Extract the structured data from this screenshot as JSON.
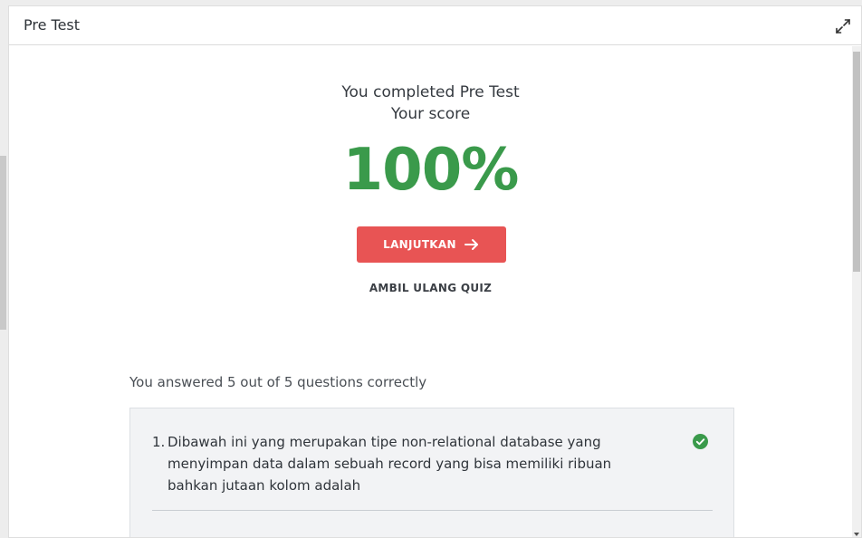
{
  "modal": {
    "title": "Pre Test",
    "expand_icon": "expand-arrows-icon"
  },
  "result": {
    "line1": "You completed Pre Test",
    "line2": "Your score",
    "score": "100%",
    "score_color": "#3a9a4b"
  },
  "actions": {
    "continue_label": "LANJUTKAN",
    "continue_icon": "arrow-right-icon",
    "continue_color": "#e85454",
    "retake_label": "AMBIL ULANG QUIZ"
  },
  "summary": {
    "text": "You answered 5 out of 5 questions correctly"
  },
  "questions": [
    {
      "number": "1.",
      "text": "Dibawah ini yang merupakan tipe non-relational database yang menyimpan data dalam sebuah record yang bisa memiliki ribuan bahkan jutaan kolom adalah",
      "status_icon": "check-circle-icon",
      "status_color": "#3a9a4b"
    }
  ]
}
